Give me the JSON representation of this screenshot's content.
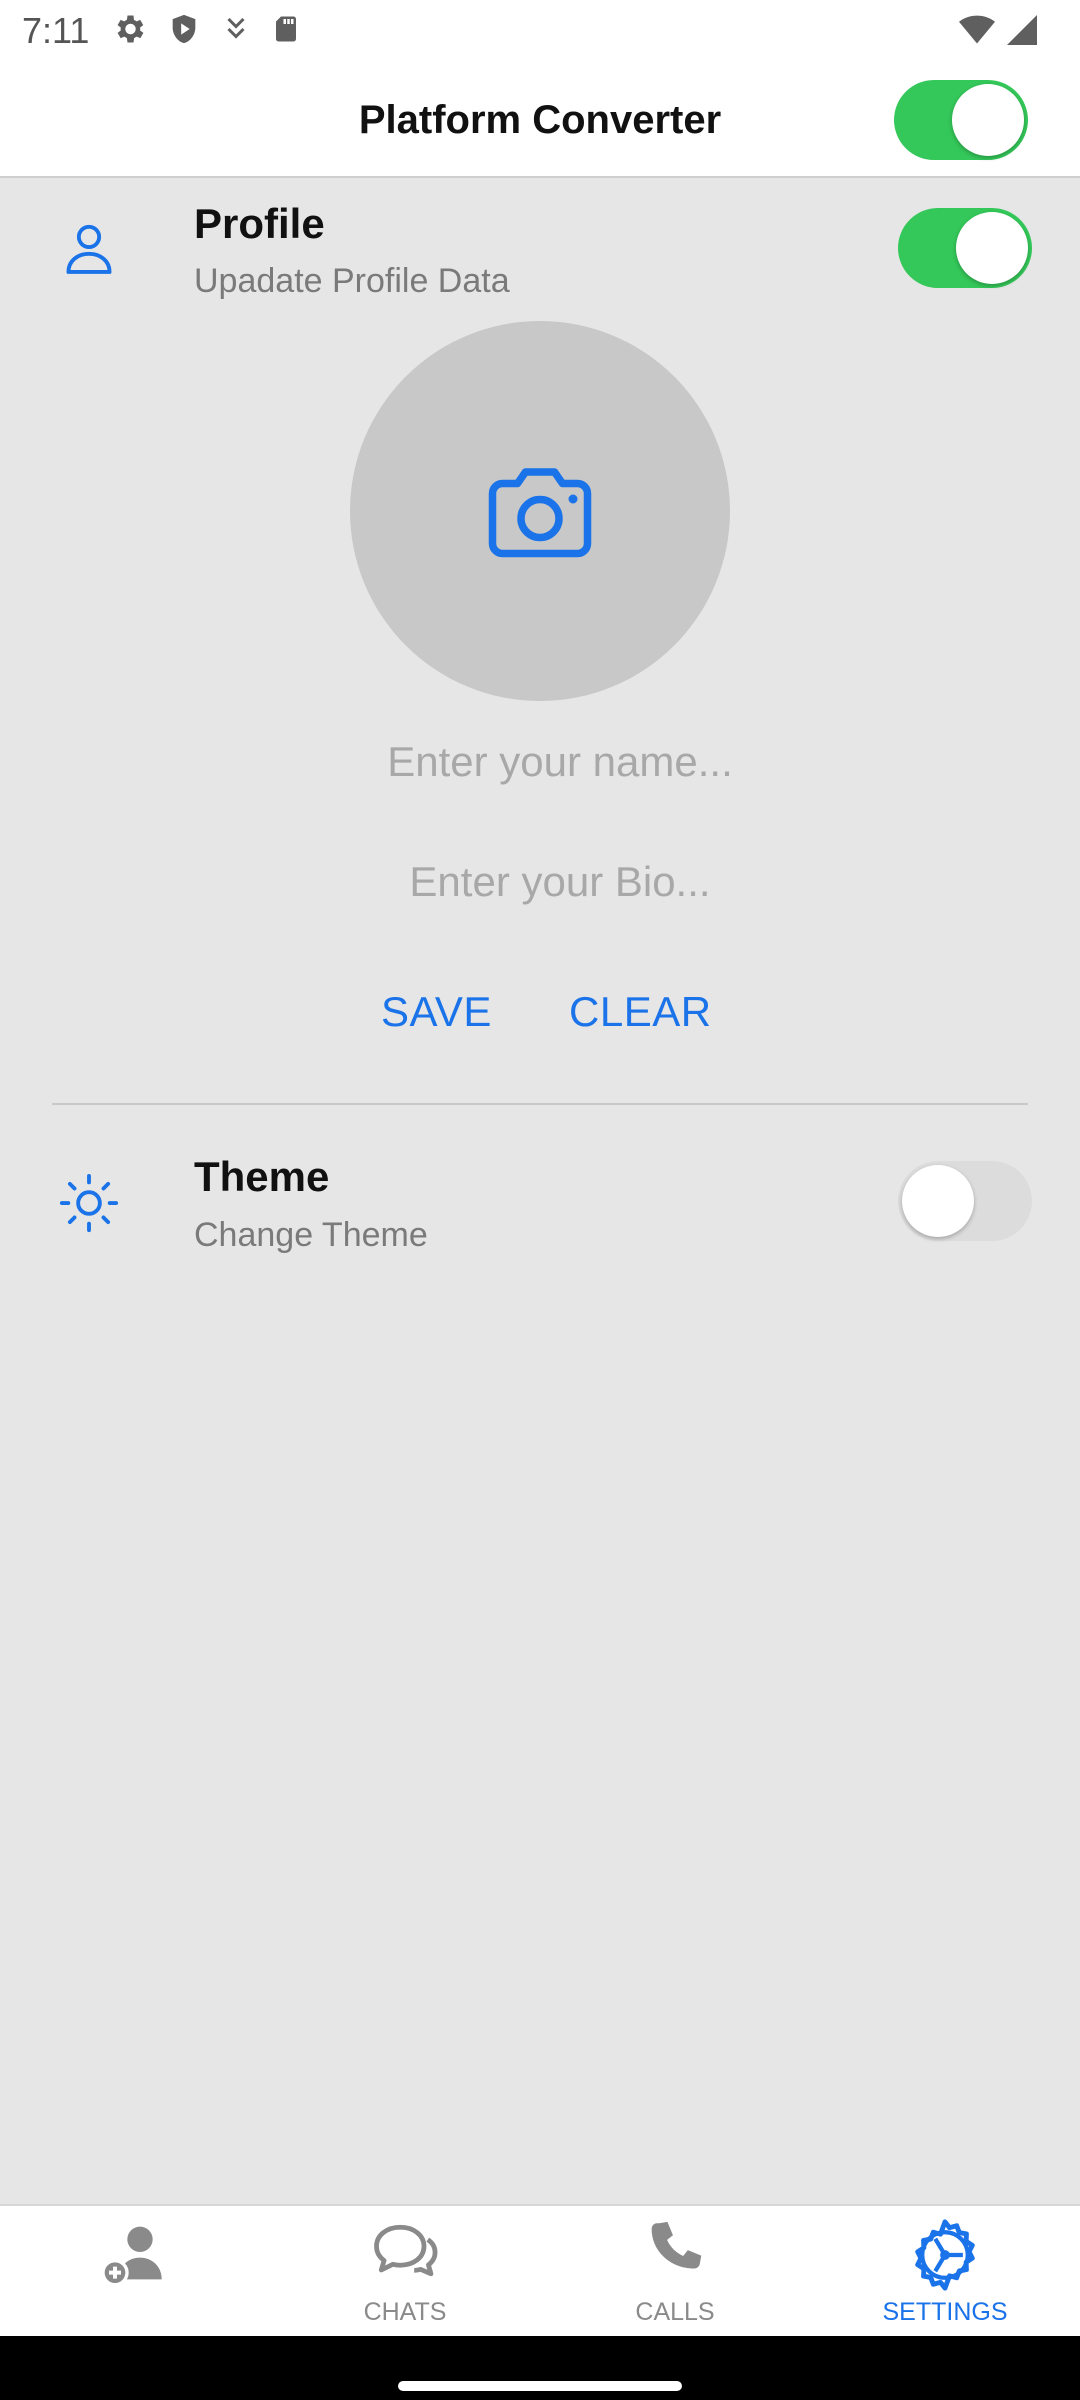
{
  "status_bar": {
    "time": "7:11",
    "icons_left": [
      "settings-icon",
      "shield-icon",
      "download-icon",
      "sd-card-icon"
    ],
    "icons_right": [
      "wifi-icon",
      "signal-icon"
    ]
  },
  "app_bar": {
    "title": "Platform Converter",
    "toggle_on": true
  },
  "profile": {
    "icon": "person-icon",
    "title": "Profile",
    "subtitle": "Upadate Profile Data",
    "toggle_on": true,
    "avatar_icon": "camera-icon",
    "name_placeholder": "Enter your name...",
    "bio_placeholder": "Enter your Bio...",
    "save_label": "SAVE",
    "clear_label": "CLEAR"
  },
  "theme": {
    "icon": "sun-icon",
    "title": "Theme",
    "subtitle": "Change Theme",
    "toggle_on": false
  },
  "tabs": [
    {
      "label": "",
      "icon": "add-person-icon",
      "active": false
    },
    {
      "label": "CHATS",
      "icon": "chat-bubbles-icon",
      "active": false
    },
    {
      "label": "CALLS",
      "icon": "phone-icon",
      "active": false
    },
    {
      "label": "SETTINGS",
      "icon": "settings-icon",
      "active": true
    }
  ],
  "colors": {
    "accent": "#1a73e8",
    "toggle_on": "#34c759",
    "background": "#e6e6e6"
  }
}
